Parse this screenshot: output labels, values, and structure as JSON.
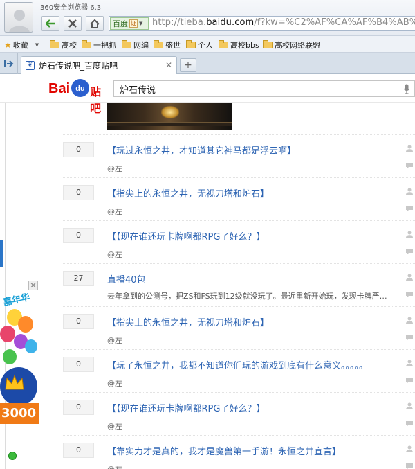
{
  "window": {
    "title": "360安全浏览器 6.3"
  },
  "address": {
    "badge": "百度",
    "url_prefix": "http://tieba.",
    "url_domain": "baidu.com",
    "url_rest": "/f?kw=%C2%AF%CA%AF%B4%AB%CB"
  },
  "bookmarks": [
    {
      "label": "收藏",
      "type": "favorites"
    },
    {
      "label": "高校"
    },
    {
      "label": "一把抓"
    },
    {
      "label": "网编"
    },
    {
      "label": "盛世"
    },
    {
      "label": "个人"
    },
    {
      "label": "高校bbs"
    },
    {
      "label": "高校网络联盟"
    }
  ],
  "tab": {
    "title": "炉石传说吧_百度贴吧"
  },
  "tieba": {
    "logo_text": "Bai",
    "logo_paw": "du",
    "logo_tieba": "贴吧",
    "search_value": "炉石传说"
  },
  "threads": [
    {
      "replies": "0",
      "title": "【玩过永恒之井，才知道其它神马都是浮云啊】",
      "author": "@左"
    },
    {
      "replies": "0",
      "title": "【指尖上的永恒之井，无视刀塔和炉石】",
      "author": "@左"
    },
    {
      "replies": "0",
      "title": "【【现在谁还玩卡牌啊都RPG了好么？】",
      "author": "@左"
    },
    {
      "replies": "27",
      "title": "直播40包",
      "excerpt": "去年拿到的公测号，把ZS和FS玩到12级就没玩了。最近重新开始玩，发现卡牌严…"
    },
    {
      "replies": "0",
      "title": "【指尖上的永恒之井，无视刀塔和炉石】",
      "author": "@左"
    },
    {
      "replies": "0",
      "title": "【玩了永恒之井，我都不知道你们玩的游戏到底有什么意义。。。。。",
      "author": "@左"
    },
    {
      "replies": "0",
      "title": "【【现在谁还玩卡牌啊都RPG了好么？】",
      "author": "@左"
    },
    {
      "replies": "0",
      "title": "【靠实力才是真的，我才是魔兽第一手游！永恒之井宣言】",
      "author": "@左"
    }
  ],
  "ad": {
    "banner": "嘉年华",
    "amount": "3000",
    "close": "✕"
  }
}
